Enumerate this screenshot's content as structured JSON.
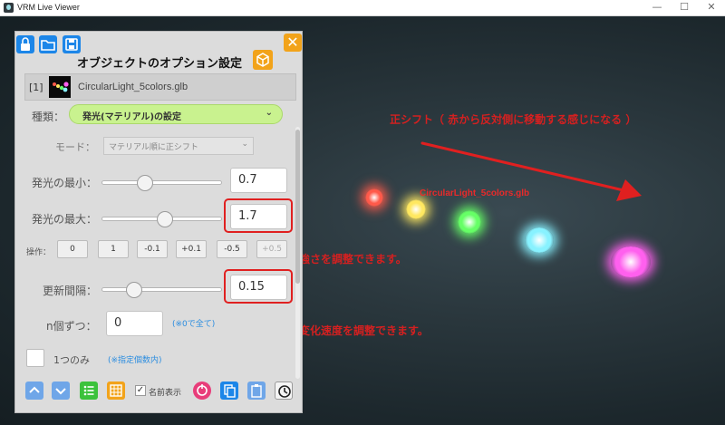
{
  "window": {
    "title": "VRM Live Viewer",
    "minimize": "—",
    "maximize": "☐",
    "close": "✕"
  },
  "panel": {
    "title": "オブジェクトのオプション設定",
    "close": "✕",
    "object": {
      "index": "[1]",
      "name": "CircularLight_5colors.glb"
    },
    "kind": {
      "label": "種類：",
      "value": "発光(マテリアル)の設定",
      "chevron": "⌄"
    },
    "mode": {
      "label": "モード：",
      "value": "マテリアル順に正シフト",
      "chevron": "⌄"
    },
    "min": {
      "label": "発光の最小：",
      "value": "0.7",
      "slider_fraction": 0.36
    },
    "max": {
      "label": "発光の最大：",
      "value": "1.7",
      "slider_fraction": 0.53
    },
    "ops": {
      "label": "操作：",
      "buttons": [
        "0",
        "1",
        "-0.1",
        "+0.1",
        "-0.5",
        "+0.5"
      ]
    },
    "interval": {
      "label": "更新間隔：",
      "value": "0.15",
      "slider_fraction": 0.27
    },
    "n_each": {
      "label": "n個ずつ：",
      "value": "0",
      "hint": "(※0で全て)"
    },
    "only_one": {
      "label": "1つのみ",
      "hint": "(※指定個数内)"
    },
    "show_name": {
      "label": "名前表示",
      "checked": "✓"
    },
    "bottom_icons": [
      "chevron-up-icon",
      "chevron-down-icon",
      "list-icon",
      "grid-icon",
      "name-checkbox",
      "reset-icon",
      "copy-icon",
      "paste-icon",
      "history-icon"
    ]
  },
  "scene": {
    "object_label": "CircularLight_5colors.glb",
    "orbs": [
      {
        "color": "#ff5a4a"
      },
      {
        "color": "#ffe860"
      },
      {
        "color": "#66ff66"
      },
      {
        "color": "#88f2ff"
      },
      {
        "color": "#ff60ee"
      }
    ]
  },
  "annotations": {
    "shift_note": "正シフト（ 赤から反対側に移動する感じになる ）",
    "strength_note": "発光の強さを調整できます。",
    "speed_note": "発光の変化速度を調整できます。"
  },
  "colors": {
    "accent_blue": "#1c86e8",
    "accent_orange": "#f2a31a",
    "select_green": "#c9f28f",
    "annotation_red": "#e02020"
  }
}
